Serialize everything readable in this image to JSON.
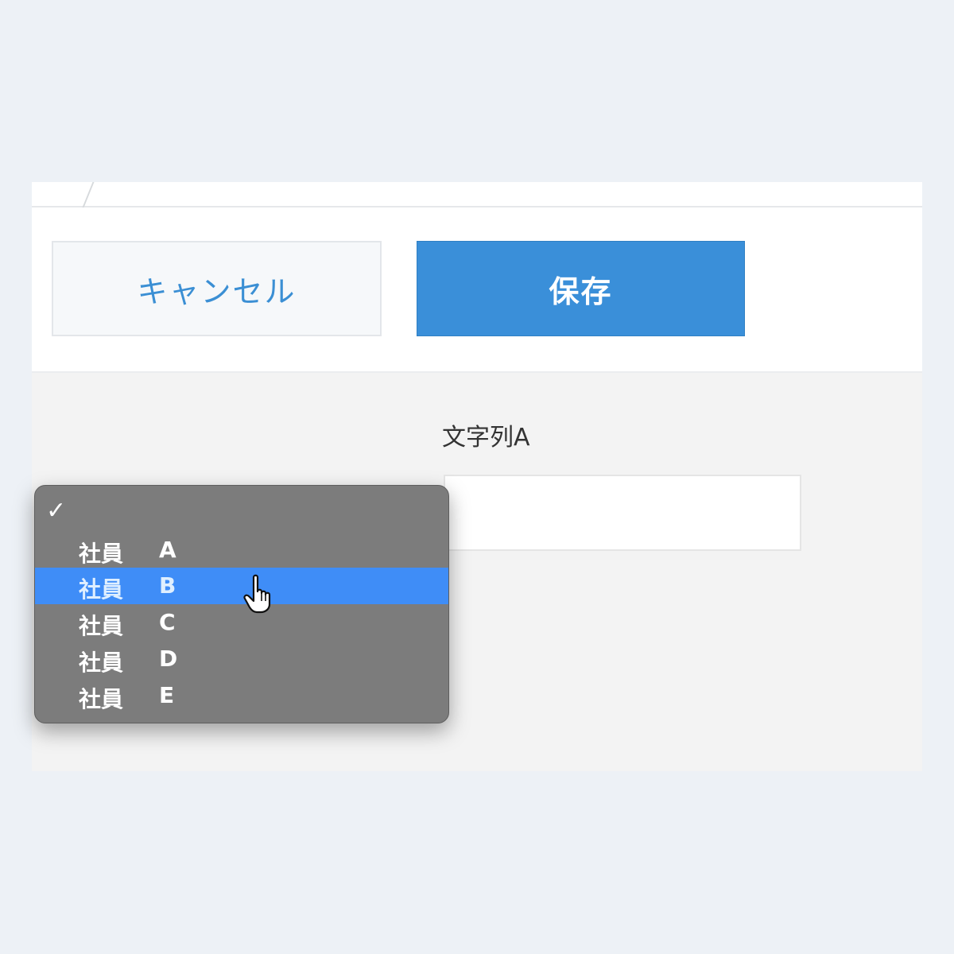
{
  "toolbar": {
    "cancel_label": "キャンセル",
    "save_label": "保存"
  },
  "form": {
    "field_label": "文字列A",
    "field_value": ""
  },
  "dropdown": {
    "checkmark": "✓",
    "selected_index": 1,
    "options": [
      {
        "prefix": "社員",
        "letter": "A"
      },
      {
        "prefix": "社員",
        "letter": "B"
      },
      {
        "prefix": "社員",
        "letter": "C"
      },
      {
        "prefix": "社員",
        "letter": "D"
      },
      {
        "prefix": "社員",
        "letter": "E"
      }
    ]
  },
  "colors": {
    "primary": "#3a8fd9",
    "highlight": "#3f8df7",
    "menu_bg": "#7c7c7c"
  },
  "icons": {
    "cursor": "hand-pointer-icon",
    "check": "checkmark-icon"
  }
}
